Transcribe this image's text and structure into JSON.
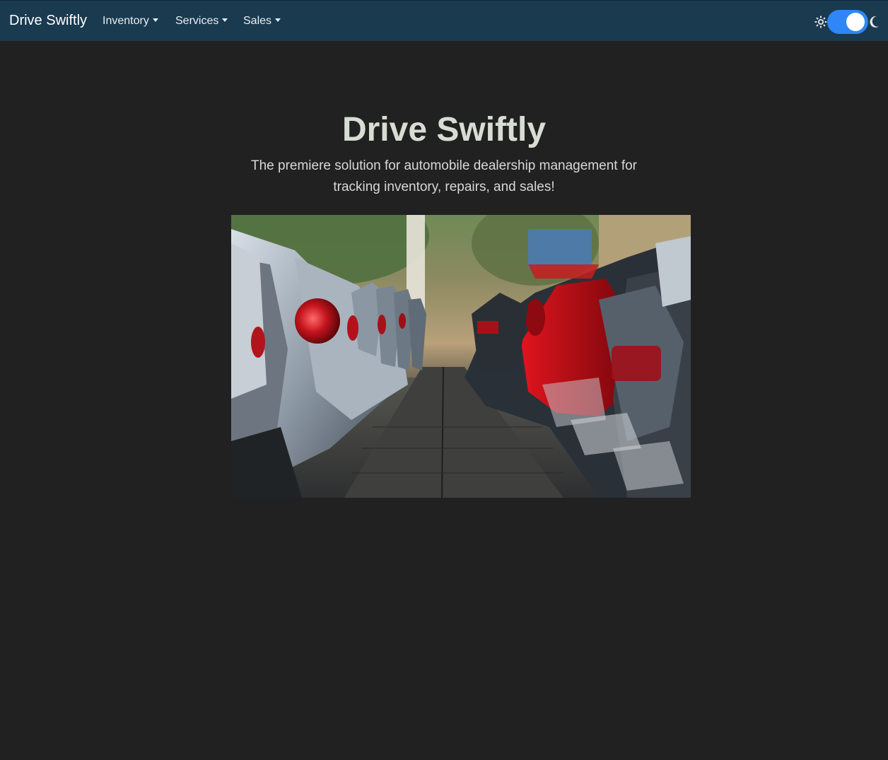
{
  "navbar": {
    "brand": "Drive Swiftly",
    "items": [
      {
        "label": "Inventory"
      },
      {
        "label": "Services"
      },
      {
        "label": "Sales"
      }
    ],
    "theme_toggle": {
      "state": "dark",
      "left_icon": "sun-icon",
      "right_icon": "moon-icon",
      "accent": "#2f86f7"
    },
    "background": "#193a4f"
  },
  "hero": {
    "title": "Drive Swiftly",
    "lead": "The premiere solution for automobile dealership management for tracking inventory, repairs, and sales!",
    "image": "photo of a row of parked cars in a dealership lot"
  },
  "colors": {
    "page_background": "#212121",
    "title": "#d8ddd4"
  }
}
